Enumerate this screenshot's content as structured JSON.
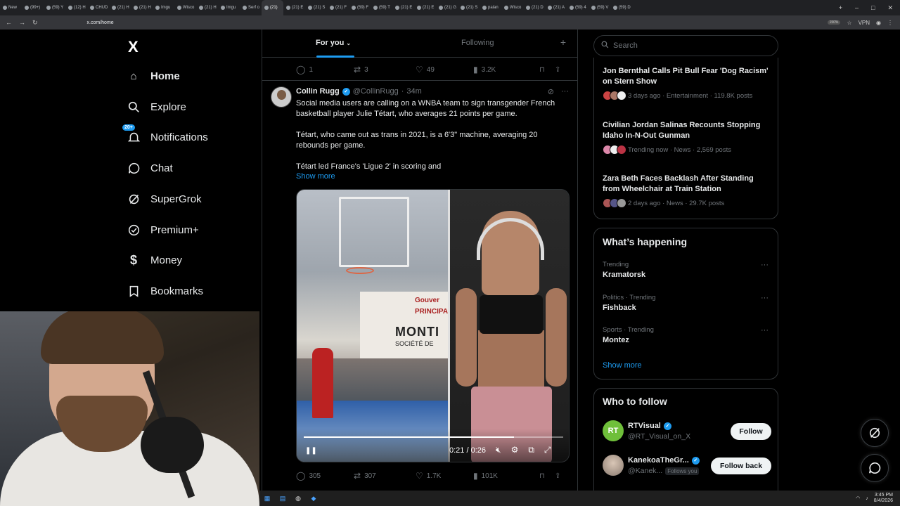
{
  "browser": {
    "tabs": [
      "New",
      "(99+)",
      "(59) Y",
      "(12) H",
      "CHUD",
      "(21) H",
      "(21) H",
      "Imgu",
      "Wisco",
      "(21) H",
      "Imgu",
      "Serf o",
      "(21)",
      "(21) E",
      "(21) S",
      "(21) F",
      "(59) F",
      "(59) T",
      "(21) E",
      "(21) E",
      "(21) G",
      "(21) S",
      "palan",
      "Wisco",
      "(21) D",
      "(21) A",
      "(59) 4",
      "(59) V",
      "(59) D"
    ],
    "active_tab_index": 12,
    "url": "x.com/home",
    "zoom": "150%",
    "vpn_label": "VPN"
  },
  "nav": {
    "logo": "X",
    "items": [
      {
        "label": "Home",
        "icon": "home-icon"
      },
      {
        "label": "Explore",
        "icon": "search-icon"
      },
      {
        "label": "Notifications",
        "icon": "bell-icon",
        "badge": "20+"
      },
      {
        "label": "Chat",
        "icon": "chat-icon"
      },
      {
        "label": "SuperGrok",
        "icon": "grok-icon"
      },
      {
        "label": "Premium+",
        "icon": "premium-icon"
      },
      {
        "label": "Money",
        "icon": "money-icon"
      },
      {
        "label": "Bookmarks",
        "icon": "bookmark-icon"
      }
    ]
  },
  "feed": {
    "tabs": {
      "for_you": "For you",
      "following": "Following"
    },
    "prev_actions": {
      "replies": "1",
      "reposts": "3",
      "likes": "49",
      "views": "3.2K"
    },
    "tweet": {
      "name": "Collin Rugg",
      "handle": "@CollinRugg",
      "time": "34m",
      "text1": "Social media users are calling on a WNBA team to sign transgender French basketball player Julie Tétart, who averages 21 points per game.",
      "text2": "Tétart, who came out as trans in 2021, is a 6'3\" machine, averaging 20 rebounds per game.",
      "text3": "Tétart led France's 'Ligue 2' in scoring and",
      "show_more": "Show more",
      "media_sign": {
        "line1": "Gouver",
        "line2": "PRINCIPAU",
        "line3": "MONTI",
        "line4": "SOCIÉTÉ DE"
      },
      "video": {
        "time": "0:21 / 0:26",
        "progress": 0.81
      },
      "actions": {
        "replies": "305",
        "reposts": "307",
        "likes": "1.7K",
        "views": "101K"
      }
    }
  },
  "right": {
    "search_placeholder": "Search",
    "news": [
      {
        "title": "Jon Bernthal Calls Pit Bull Fear 'Dog Racism' on Stern Show",
        "meta": "3 days ago · Entertainment · 119.8K posts"
      },
      {
        "title": "Civilian Jordan Salinas Recounts Stopping Idaho In-N-Out Gunman",
        "meta": "Trending now · News · 2,569 posts"
      },
      {
        "title": "Zara Beth Faces Backlash After Standing from Wheelchair at Train Station",
        "meta": "2 days ago · News · 29.7K posts"
      }
    ],
    "happening": {
      "title": "What’s happening",
      "trends": [
        {
          "context": "Trending",
          "name": "Kramatorsk"
        },
        {
          "context": "Politics · Trending",
          "name": "Fishback"
        },
        {
          "context": "Sports · Trending",
          "name": "Montez"
        }
      ],
      "show_more": "Show more"
    },
    "who_to_follow": {
      "title": "Who to follow",
      "accounts": [
        {
          "name": "RTVisual",
          "handle": "@RT_Visual_on_X",
          "button": "Follow",
          "avatar_text": "RT"
        },
        {
          "name": "KanekoaTheGr...",
          "handle": "@Kanek...",
          "follows_you": "Follows you",
          "button": "Follow back"
        }
      ]
    }
  },
  "taskbar": {
    "time": "3:45 PM",
    "date": "8/4/2026"
  },
  "colors": {
    "accent": "#1d9bf0",
    "bg": "#000000",
    "border": "#2f3336",
    "muted": "#71767b"
  }
}
